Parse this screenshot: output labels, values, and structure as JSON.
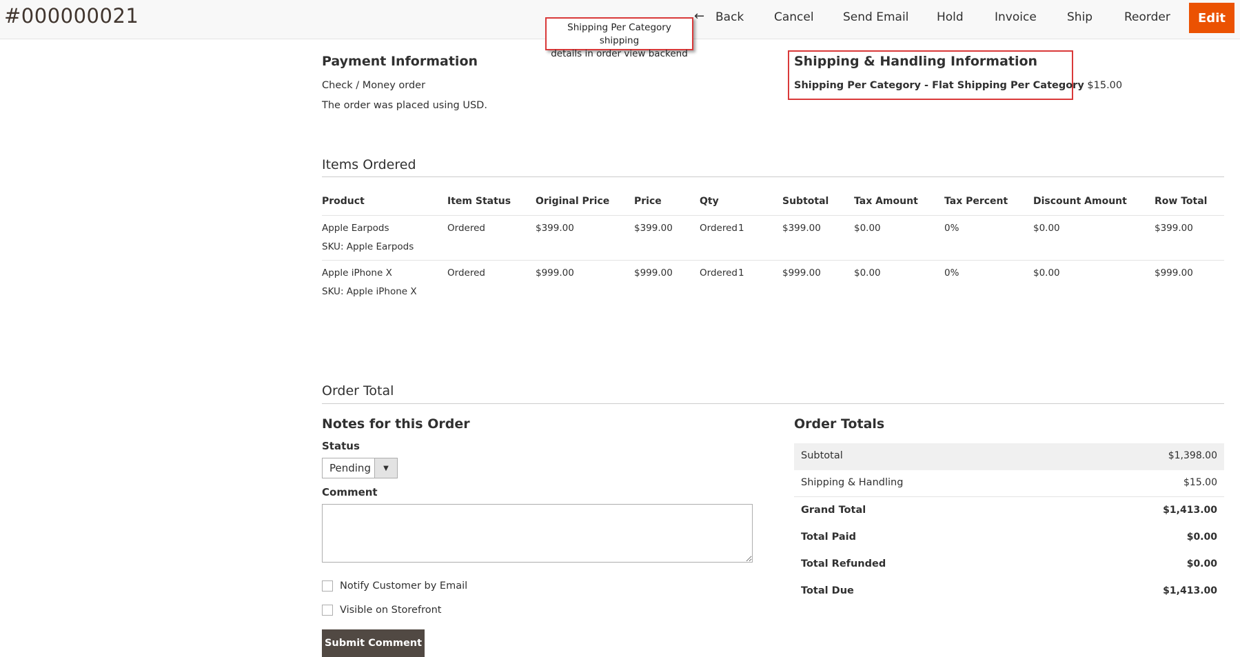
{
  "header": {
    "order_number": "#000000021",
    "buttons": {
      "back": "Back",
      "cancel": "Cancel",
      "send_email": "Send Email",
      "hold": "Hold",
      "invoice": "Invoice",
      "ship": "Ship",
      "reorder": "Reorder",
      "edit": "Edit"
    },
    "back_arrow": "←"
  },
  "callout": {
    "text_line1": "Shipping Per Category shipping",
    "text_line2": "details in order view backend"
  },
  "payment": {
    "title": "Payment Information",
    "method": "Check / Money order",
    "currency_note": "The order was placed using USD."
  },
  "shipping": {
    "title": "Shipping & Handling Information",
    "method": "Shipping Per Category - Flat Shipping Per Category",
    "amount": "$15.00"
  },
  "items": {
    "title": "Items Ordered",
    "columns": [
      "Product",
      "Item Status",
      "Original Price",
      "Price",
      "Qty",
      "Subtotal",
      "Tax Amount",
      "Tax Percent",
      "Discount Amount",
      "Row Total"
    ],
    "rows": [
      {
        "product": "Apple Earpods",
        "sku": "SKU: Apple Earpods",
        "status": "Ordered",
        "original_price": "$399.00",
        "price": "$399.00",
        "qty_label": "Ordered",
        "qty": "1",
        "subtotal": "$399.00",
        "tax_amount": "$0.00",
        "tax_percent": "0%",
        "discount": "$0.00",
        "row_total": "$399.00"
      },
      {
        "product": "Apple iPhone X",
        "sku": "SKU: Apple iPhone X",
        "status": "Ordered",
        "original_price": "$999.00",
        "price": "$999.00",
        "qty_label": "Ordered",
        "qty": "1",
        "subtotal": "$999.00",
        "tax_amount": "$0.00",
        "tax_percent": "0%",
        "discount": "$0.00",
        "row_total": "$999.00"
      }
    ]
  },
  "order_total": {
    "title": "Order Total",
    "notes": {
      "title": "Notes for this Order",
      "status_label": "Status",
      "status_value": "Pending",
      "comment_label": "Comment",
      "comment_value": "",
      "notify_label": "Notify Customer by Email",
      "visible_label": "Visible on Storefront",
      "submit_label": "Submit Comment"
    },
    "totals": {
      "title": "Order Totals",
      "rows": [
        {
          "label": "Subtotal",
          "amount": "$1,398.00"
        },
        {
          "label": "Shipping & Handling",
          "amount": "$15.00"
        },
        {
          "label": "Grand Total",
          "amount": "$1,413.00"
        },
        {
          "label": "Total Paid",
          "amount": "$0.00"
        },
        {
          "label": "Total Refunded",
          "amount": "$0.00"
        },
        {
          "label": "Total Due",
          "amount": "$1,413.00"
        }
      ]
    }
  },
  "colors": {
    "accent": "#eb5202",
    "callout_border": "#d93939",
    "submit_bg": "#514943"
  },
  "icons": {
    "back": "arrow-left-icon",
    "select": "caret-down-icon"
  }
}
